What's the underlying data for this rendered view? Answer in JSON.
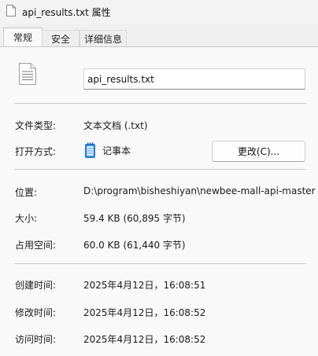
{
  "window": {
    "title": "api_results.txt 属性",
    "title_icon": "text-file-icon"
  },
  "tabs": [
    {
      "label": "常规",
      "active": true
    },
    {
      "label": "安全",
      "active": false
    },
    {
      "label": "详细信息",
      "active": false
    }
  ],
  "general": {
    "file_icon": "text-document-icon",
    "filename": "api_results.txt",
    "file_type_label": "文件类型:",
    "file_type_value": "文本文档 (.txt)",
    "opens_with_label": "打开方式:",
    "opens_with_app": "记事本",
    "opens_with_app_icon": "notepad-icon",
    "change_button": "更改(C)...",
    "location_label": "位置:",
    "location_value": "D:\\program\\bisheshiyan\\newbee-mall-api-master",
    "size_label": "大小:",
    "size_value": "59.4 KB (60,895 字节)",
    "size_on_disk_label": "占用空间:",
    "size_on_disk_value": "60.0 KB (61,440 字节)",
    "created_label": "创建时间:",
    "created_value": "2025年4月12日，16:08:51",
    "modified_label": "修改时间:",
    "modified_value": "2025年4月12日，16:08:52",
    "accessed_label": "访问时间:",
    "accessed_value": "2025年4月12日，16:08:52"
  },
  "colors": {
    "window_bg": "#f0f0f0",
    "panel_bg": "#f9f9f9",
    "separator": "#c8c8c8",
    "notepad_blue": "#3a8ee6"
  }
}
